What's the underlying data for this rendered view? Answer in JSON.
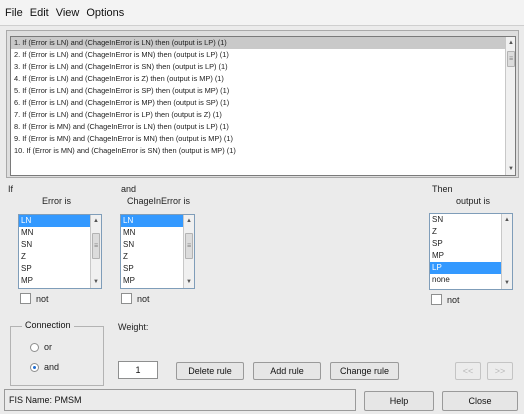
{
  "menu": [
    "File",
    "Edit",
    "View",
    "Options"
  ],
  "rules": [
    "1. If (Error is LN) and (ChageInError is LN) then (output is LP) (1)",
    "2. If (Error is LN) and (ChageInError is MN) then (output is LP) (1)",
    "3. If (Error is LN) and (ChageInError is SN) then (output is LP) (1)",
    "4. If (Error is LN) and (ChageInError is Z) then (output is MP) (1)",
    "5. If (Error is LN) and (ChageInError is SP) then (output is MP) (1)",
    "6. If (Error is LN) and (ChageInError is MP) then (output is SP) (1)",
    "7. If (Error is LN) and (ChageInError is LP) then (output is Z) (1)",
    "8. If (Error is MN) and (ChageInError is LN) then (output is LP) (1)",
    "9. If (Error is MN) and (ChageInError is MN) then (output is MP) (1)",
    "10. If (Error is MN) and (ChageInError is SN) then (output is MP) (1)"
  ],
  "antecedent": {
    "if_label": "If",
    "and_label": "and",
    "error_label": "Error is",
    "change_label": "ChageInError is",
    "error_options": [
      "LN",
      "MN",
      "SN",
      "Z",
      "SP",
      "MP"
    ],
    "change_options": [
      "LN",
      "MN",
      "SN",
      "Z",
      "SP",
      "MP"
    ],
    "error_selected": "LN",
    "change_selected": "LN"
  },
  "consequent": {
    "then_label": "Then",
    "output_label": "output is",
    "options": [
      "SN",
      "Z",
      "SP",
      "MP",
      "LP",
      "none"
    ],
    "selected": "LP"
  },
  "not_label": "not",
  "connection": {
    "title": "Connection",
    "or_label": "or",
    "and_label": "and",
    "selected": "and"
  },
  "weight": {
    "label": "Weight:",
    "value": "1"
  },
  "buttons": {
    "delete": "Delete rule",
    "add": "Add rule",
    "change": "Change rule",
    "prev": "<<",
    "next": ">>",
    "help": "Help",
    "close": "Close"
  },
  "status": "FIS Name: PMSM"
}
